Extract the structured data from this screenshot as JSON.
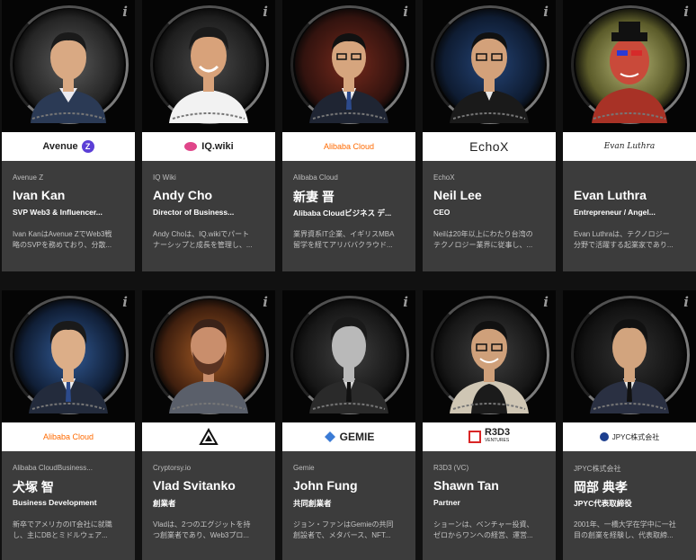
{
  "cards": [
    {
      "company": "Avenue Z",
      "name": "Ivan Kan",
      "title": "SVP Web3 & Influencer...",
      "bio1": "Ivan KanはAvenue ZでWeb3戦",
      "bio2": "略のSVPを務めており、分散...",
      "logo": "Avenue",
      "logo_mark": "Z",
      "glow": "#8a8a8a",
      "skin": "#d9a983",
      "suit": "#2b3a55"
    },
    {
      "company": "IQ Wiki",
      "name": "Andy Cho",
      "title": "Director of Business...",
      "bio1": "Andy Choは、IQ.wikiでパート",
      "bio2": "ナーシップと成長を管理し、...",
      "logo": "IQ.wiki",
      "logo_mark": "",
      "glow": "#7a7a7a",
      "skin": "#d8a27a",
      "suit": "#f2f2f2"
    },
    {
      "company": "Alibaba Cloud",
      "name": "新妻 晋",
      "title": "Alibaba Cloudビジネス デ...",
      "bio1": "業界資系IT企業、イギリスMBA",
      "bio2": "留学を経てアリババクラウド...",
      "logo": "Alibaba Cloud",
      "logo_mark": "",
      "glow": "#9b3a2a",
      "skin": "#d6a57e",
      "suit": "#1f2533"
    },
    {
      "company": "EchoX",
      "name": "Neil Lee",
      "title": "CEO",
      "bio1": "Neilは20年以上にわたり台湾の",
      "bio2": "テクノロジー業界に従事し、...",
      "logo": "EchoX",
      "logo_mark": "",
      "glow": "#2a4f8a",
      "skin": "#d3a17a",
      "suit": "#1a1a1a"
    },
    {
      "company": "",
      "name": "Evan Luthra",
      "title": "Entrepreneur / Angel...",
      "bio1": "Evan Luthraは、テクノロジー",
      "bio2": "分野で活躍する起業家であり...",
      "logo": "Evan Luthra",
      "logo_mark": "",
      "glow": "#8a8a3a",
      "skin": "#c94a3a",
      "suit": "#a83226"
    },
    {
      "company": "Alibaba CloudBusiness...",
      "name": "犬塚 智",
      "title": "Business Development",
      "bio1": "新卒でアメリカのIT会社に就職",
      "bio2": "し、主にDBとミドルウェア...",
      "logo": "Alibaba Cloud",
      "logo_mark": "",
      "glow": "#2a4f8a",
      "skin": "#dcae88",
      "suit": "#232b3c"
    },
    {
      "company": "Cryptorsy.io",
      "name": "Vlad Svitanko",
      "title": "創業者",
      "bio1": "Vladは、2つのエグジットを持",
      "bio2": "つ創業者であり、Web3プロ...",
      "logo": "",
      "logo_mark": "",
      "glow": "#a8572a",
      "skin": "#c98e6c",
      "suit": "#5a5f6a"
    },
    {
      "company": "Gemie",
      "name": "John Fung",
      "title": "共同創業者",
      "bio1": "ジョン・ファンはGemieの共同",
      "bio2": "創設者で、メタバース、NFT...",
      "logo": "GEMIE",
      "logo_mark": "",
      "glow": "#555555",
      "skin": "#b9b9b9",
      "suit": "#2a2a2a"
    },
    {
      "company": "R3D3 (VC)",
      "name": "Shawn Tan",
      "title": "Partner",
      "bio1": "ショーンは、ベンチャー投資、",
      "bio2": "ゼロからワンへの経営、運営...",
      "logo": "R3D3",
      "logo_mark": "VENTURES",
      "glow": "#555555",
      "skin": "#cfa07a",
      "suit": "#1b1b1b"
    },
    {
      "company": "JPYC株式会社",
      "name": "岡部 典孝",
      "title": "JPYC代表取締役",
      "bio1": "2001年、一橋大学在学中に一社",
      "bio2": "目の創業を経験し、代表取締...",
      "logo": "JPYC株式会社",
      "logo_mark": "",
      "glow": "#333333",
      "skin": "#d2a47e",
      "suit": "#2a3042"
    }
  ],
  "info_label": "i",
  "colors": {
    "avenue": "#5b3fd6",
    "alibaba": "#ff6a00",
    "iq": "#e0468a",
    "gemie": "#3a7bd5",
    "r3d3": "#d92626",
    "jpyc": "#1d3f8f"
  }
}
